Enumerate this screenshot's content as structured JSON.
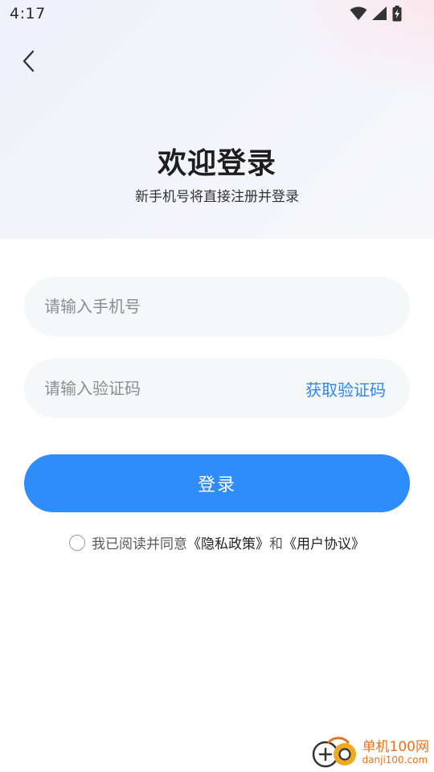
{
  "status_bar": {
    "time": "4:17",
    "icons": [
      "wifi-icon",
      "signal-icon",
      "battery-charging-icon"
    ]
  },
  "header": {
    "back_icon": "chevron-left-icon",
    "title": "欢迎登录",
    "subtitle": "新手机号将直接注册并登录"
  },
  "form": {
    "phone": {
      "value": "",
      "placeholder": "请输入手机号"
    },
    "code": {
      "value": "",
      "placeholder": "请输入验证码",
      "get_code_label": "获取验证码"
    },
    "login_label": "登录"
  },
  "agreement": {
    "checked": false,
    "prefix": "我已阅读并同意",
    "privacy_link": "《隐私政策》",
    "conjunction": "和",
    "terms_link": "《用户协议》"
  },
  "watermark": {
    "title": "单机100网",
    "url": "danji100.com"
  },
  "colors": {
    "accent": "#2f8cfb",
    "link_blue": "#2d86f6",
    "field_bg": "#f6f7f9",
    "watermark_orange": "#e8731c"
  }
}
